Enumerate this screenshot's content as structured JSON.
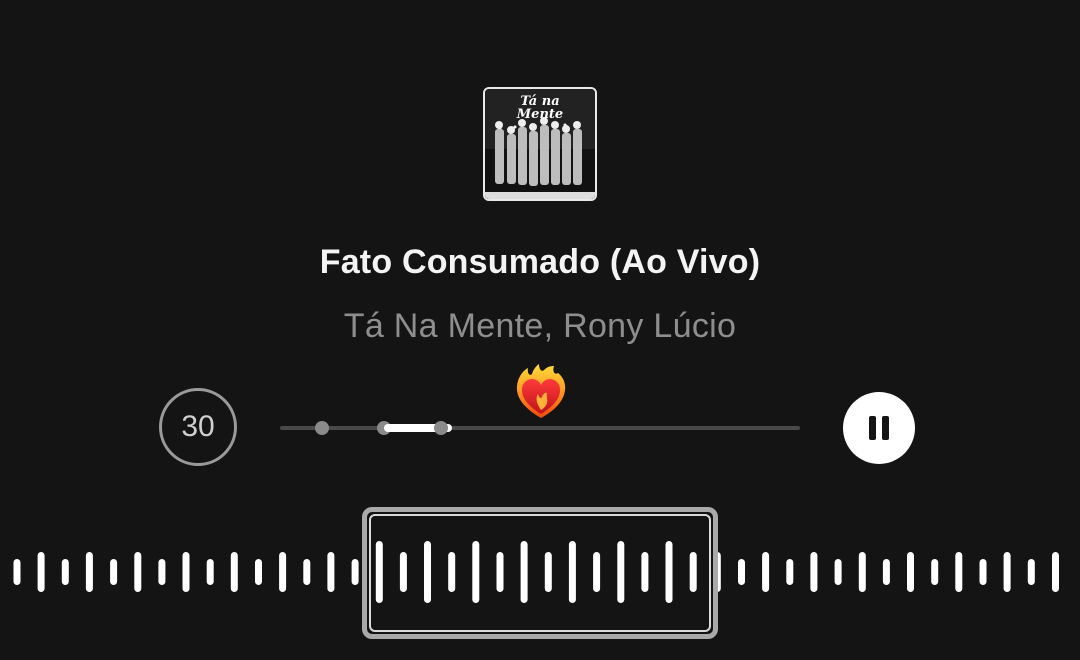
{
  "track": {
    "title": "Fato Consumado (Ao Vivo)",
    "artists": "Tá Na Mente, Rony Lúcio",
    "album_art_text": "Tá na Mente"
  },
  "controls": {
    "skip_label": "30",
    "skip_icon": "skip-30-icon",
    "play_state_icon": "pause-icon"
  },
  "progress": {
    "selection_start": 0.2,
    "selection_end": 0.33,
    "markers": [
      0.08,
      0.2,
      0.31
    ]
  },
  "reaction": {
    "icon": "heart-on-fire-emoji"
  },
  "colors": {
    "background": "#141414",
    "title": "#f4f4f4",
    "subtitle": "#8e8e8e",
    "accent": "#ffffff"
  }
}
